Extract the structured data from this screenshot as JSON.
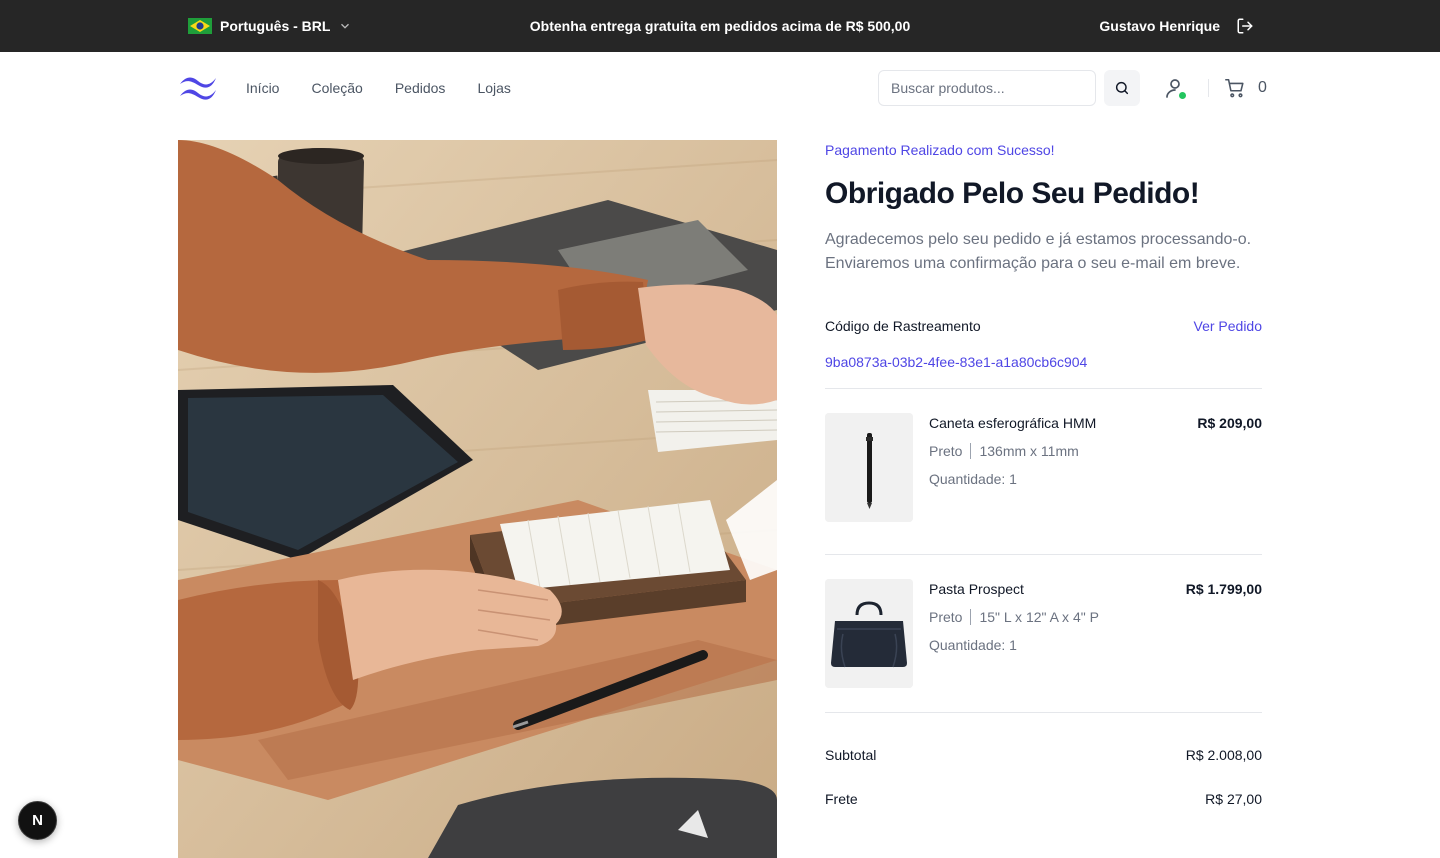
{
  "topbar": {
    "language": "Português - BRL",
    "promo": "Obtenha entrega gratuita em pedidos acima de R$ 500,00",
    "user_name": "Gustavo Henrique"
  },
  "nav": {
    "items": [
      "Início",
      "Coleção",
      "Pedidos",
      "Lojas"
    ],
    "search_placeholder": "Buscar produtos...",
    "cart_count": "0"
  },
  "order": {
    "eyebrow": "Pagamento Realizado com Sucesso!",
    "title": "Obrigado Pelo Seu Pedido!",
    "description": "Agradecemos pelo seu pedido e já estamos processando-o. Enviaremos uma confirmação para o seu e-mail em breve.",
    "tracking_label": "Código de Rastreamento",
    "view_order": "Ver Pedido",
    "tracking_code": "9ba0873a-03b2-4fee-83e1-a1a80cb6c904",
    "items": [
      {
        "name": "Caneta esferográfica HMM",
        "color": "Preto",
        "size": "136mm x 11mm",
        "quantity": "Quantidade: 1",
        "price": "R$ 209,00"
      },
      {
        "name": "Pasta Prospect",
        "color": "Preto",
        "size": "15\" L x 12\" A x 4\" P",
        "quantity": "Quantidade: 1",
        "price": "R$ 1.799,00"
      }
    ],
    "subtotal_label": "Subtotal",
    "subtotal": "R$ 2.008,00",
    "shipping_label": "Frete",
    "shipping": "R$ 27,00"
  },
  "badge": "N"
}
